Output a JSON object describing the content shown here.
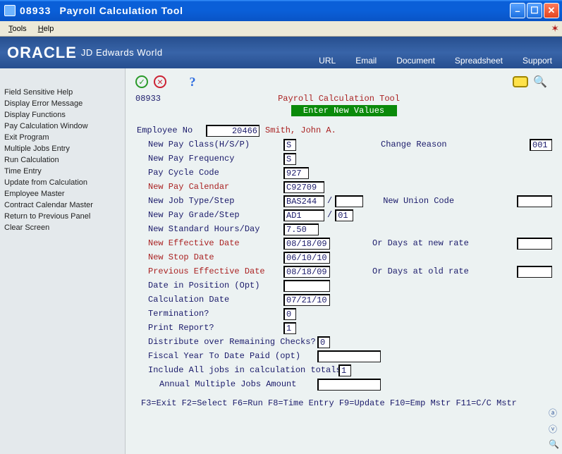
{
  "window": {
    "code": "08933",
    "title": "Payroll Calculation Tool"
  },
  "menu": {
    "tools": "Tools",
    "help": "Help"
  },
  "header": {
    "logo": "ORACLE",
    "tagline": "JD Edwards World",
    "links": {
      "url": "URL",
      "email": "Email",
      "document": "Document",
      "spreadsheet": "Spreadsheet",
      "support": "Support"
    }
  },
  "sidebar": {
    "items": [
      "Field Sensitive Help",
      "Display Error Message",
      "Display Functions",
      "Pay Calculation Window",
      "Exit Program",
      "Multiple Jobs Entry",
      "Run Calculation",
      "Time Entry",
      "Update from Calculation",
      "Employee Master",
      "Contract Calendar Master",
      "Return to Previous Panel",
      "Clear Screen"
    ]
  },
  "screen": {
    "id": "08933",
    "title": "Payroll Calculation Tool",
    "banner": "Enter New Values"
  },
  "emp": {
    "label": "Employee No",
    "no": "20466",
    "name": "Smith, John A."
  },
  "change_reason": {
    "label": "Change Reason",
    "value": "001"
  },
  "fields": {
    "pay_class": {
      "label": "New Pay Class(H/S/P)",
      "value": "S"
    },
    "pay_freq": {
      "label": "New Pay Frequency",
      "value": "S"
    },
    "pay_cycle": {
      "label": "Pay Cycle Code",
      "value": "927"
    },
    "pay_calendar": {
      "label": "New Pay Calendar",
      "value": "C92709",
      "hot": true
    },
    "job_type": {
      "label": "New Job Type/Step",
      "value": "BAS244",
      "step": ""
    },
    "union": {
      "label": "New Union Code",
      "value": ""
    },
    "pay_grade": {
      "label": "New Pay Grade/Step",
      "value": "AD1",
      "step": "01"
    },
    "std_hours": {
      "label": "New Standard Hours/Day",
      "value": "7.50"
    },
    "eff_date": {
      "label": "New Effective Date",
      "value": "08/18/09",
      "hot": true
    },
    "days_new": {
      "label": "Or Days at new rate",
      "value": ""
    },
    "stop_date": {
      "label": "New Stop Date",
      "value": "06/10/10",
      "hot": true
    },
    "prev_eff": {
      "label": "Previous Effective Date",
      "value": "08/18/09",
      "hot": true
    },
    "days_old": {
      "label": "Or Days at old rate",
      "value": ""
    },
    "date_in_pos": {
      "label": "Date in Position (Opt)",
      "value": ""
    },
    "calc_date": {
      "label": "Calculation Date",
      "value": "07/21/10"
    },
    "termination": {
      "label": "Termination?",
      "value": "0"
    },
    "print_report": {
      "label": "Print Report?",
      "value": "1"
    },
    "dist_checks": {
      "label": "Distribute over Remaining Checks?",
      "value": "0"
    },
    "fytd_paid": {
      "label": "Fiscal Year To Date Paid (opt)",
      "value": ""
    },
    "include_all": {
      "label": "Include All jobs in calculation totals",
      "value": "1"
    },
    "annual_mj": {
      "label": "Annual Multiple Jobs Amount",
      "value": ""
    }
  },
  "footer": "F3=Exit F2=Select F6=Run F8=Time Entry F9=Update F10=Emp Mstr F11=C/C Mstr"
}
